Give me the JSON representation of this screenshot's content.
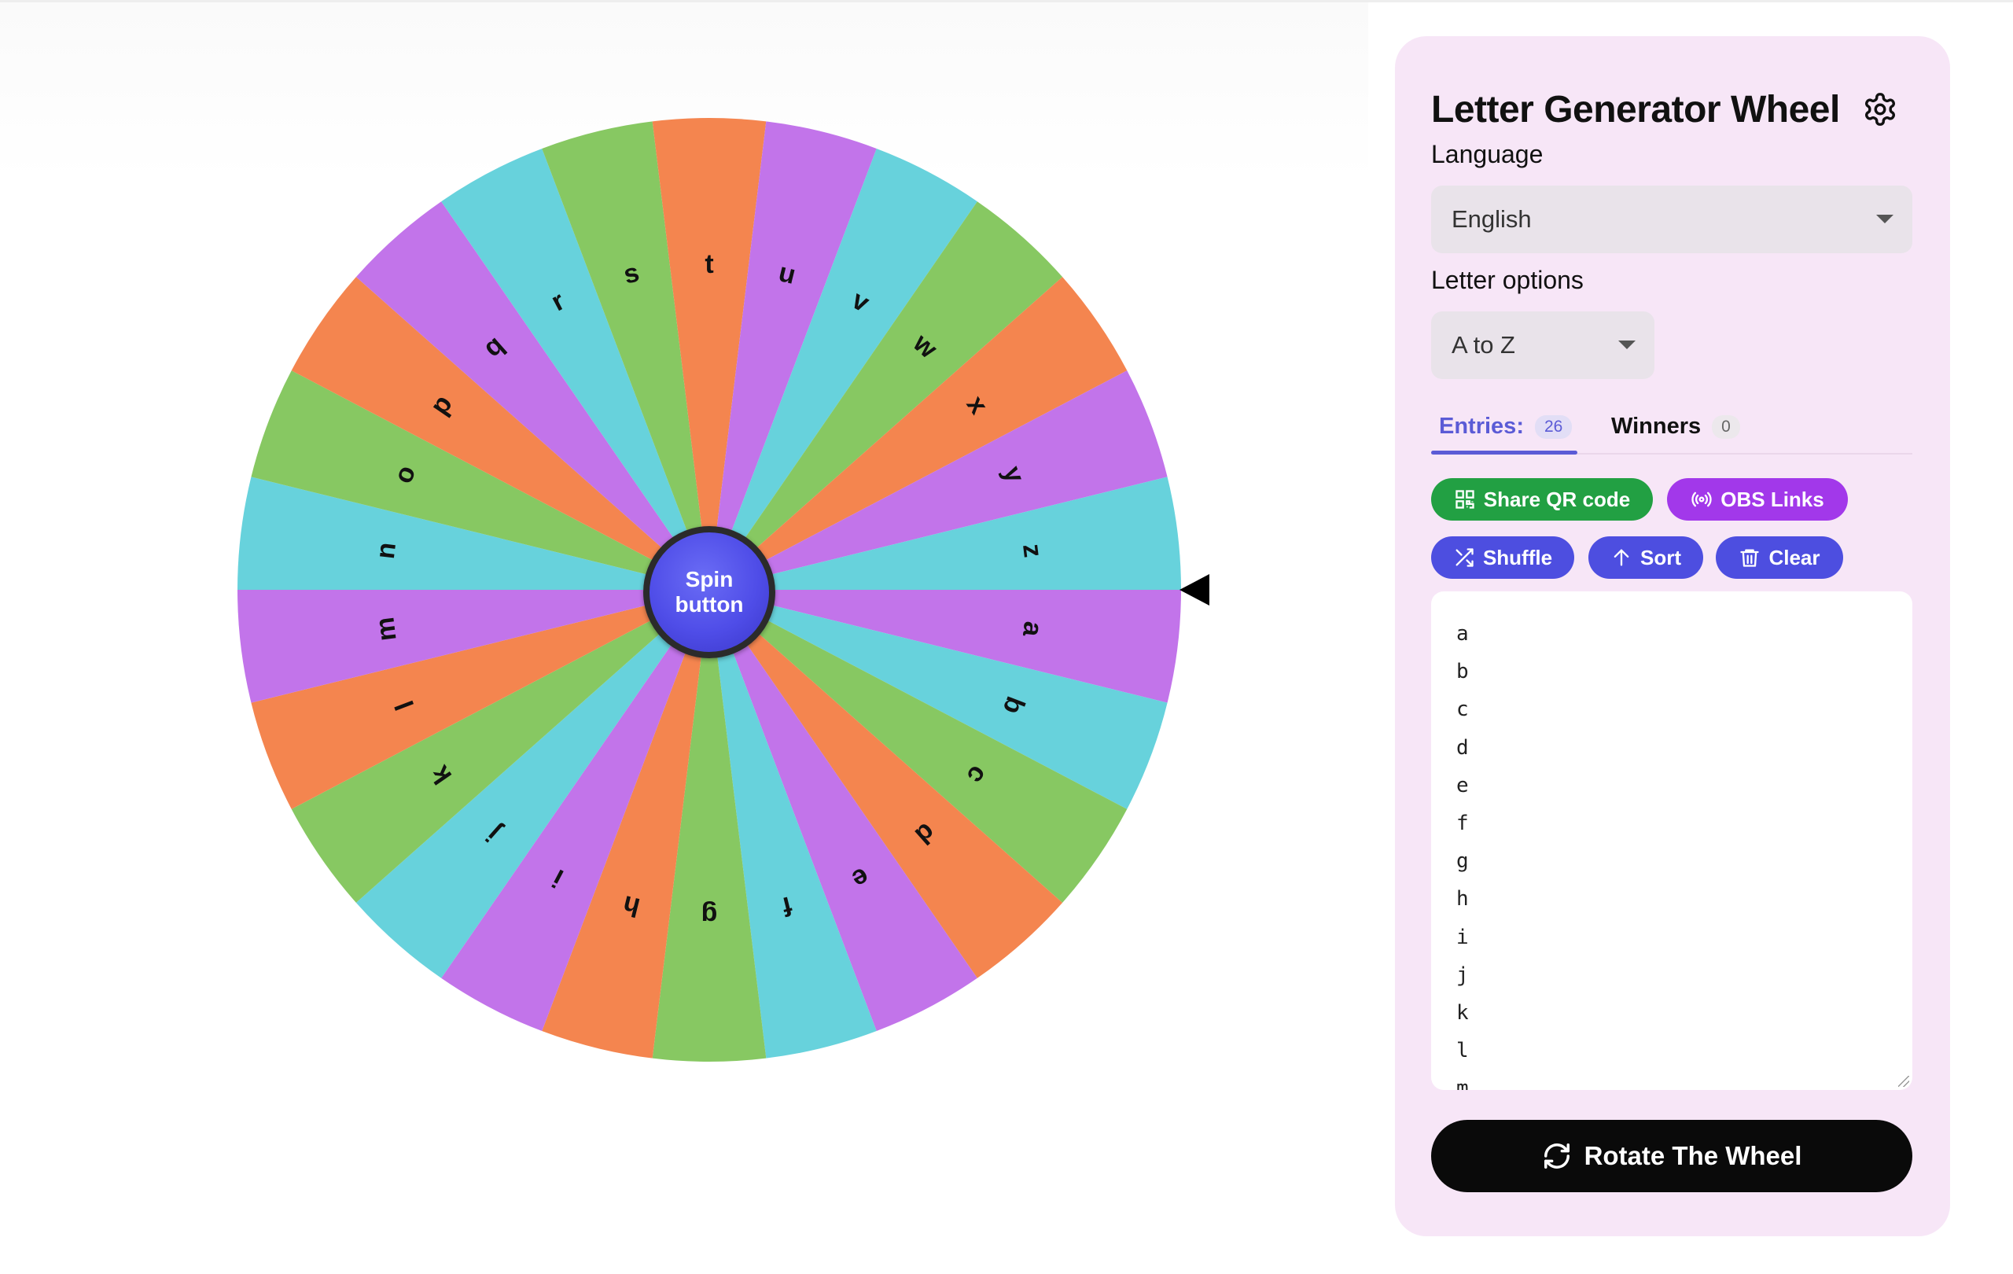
{
  "app": {
    "title": "Letter Generator Wheel"
  },
  "wheel": {
    "spin_label": "Spin button",
    "segments": [
      "a",
      "b",
      "c",
      "d",
      "e",
      "f",
      "g",
      "h",
      "i",
      "j",
      "k",
      "l",
      "m",
      "n",
      "o",
      "p",
      "q",
      "r",
      "s",
      "t",
      "u",
      "v",
      "w",
      "x",
      "y",
      "z"
    ],
    "colors": [
      "#c274ea",
      "#67d2dc",
      "#87c862",
      "#f4854f"
    ]
  },
  "settings": {
    "language_label": "Language",
    "language_value": "English",
    "letter_options_label": "Letter options",
    "letter_options_value": "A to Z"
  },
  "tabs": {
    "entries_label": "Entries:",
    "entries_count": "26",
    "winners_label": "Winners",
    "winners_count": "0"
  },
  "actions": {
    "share_qr": "Share QR code",
    "obs_links": "OBS Links",
    "shuffle": "Shuffle",
    "sort": "Sort",
    "clear": "Clear"
  },
  "entries": [
    "a",
    "b",
    "c",
    "d",
    "e",
    "f",
    "g",
    "h",
    "i",
    "j",
    "k",
    "l",
    "m"
  ],
  "rotate_label": "Rotate The Wheel",
  "icons": {
    "settings": "gear-icon",
    "share": "qr-code-icon",
    "obs": "broadcast-icon",
    "shuffle": "shuffle-icon",
    "sort": "arrow-up-icon",
    "clear": "trash-icon",
    "rotate": "refresh-icon"
  }
}
